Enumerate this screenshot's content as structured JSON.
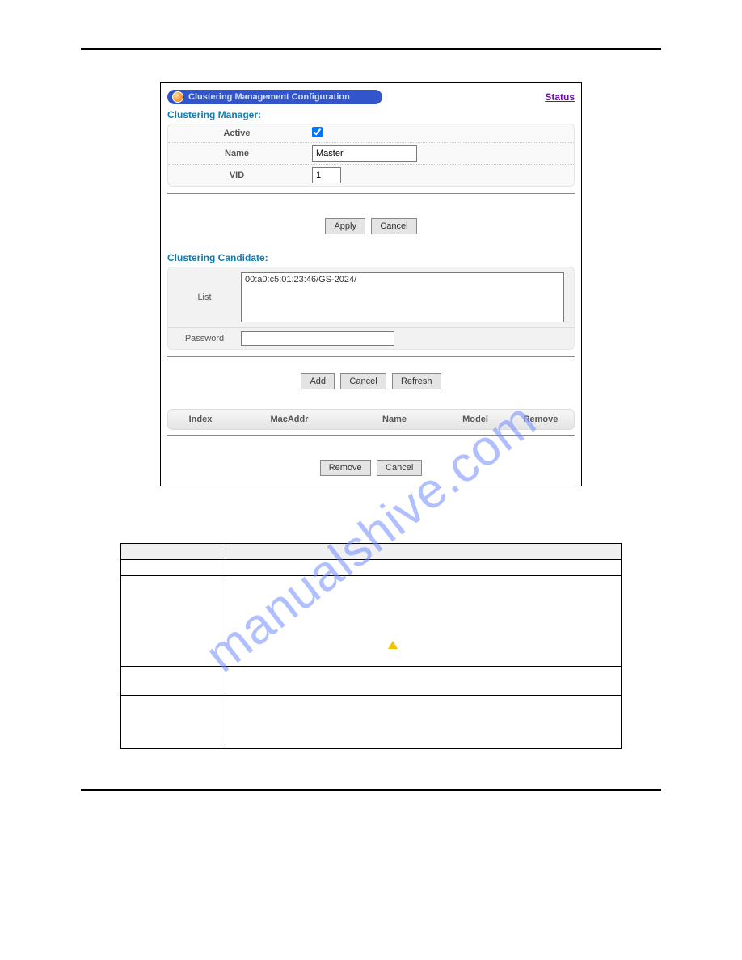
{
  "watermark": "manualshive.com",
  "panel": {
    "title": "Clustering Management Configuration",
    "status_link": "Status"
  },
  "manager": {
    "section_title": "Clustering Manager:",
    "labels": {
      "active": "Active",
      "name": "Name",
      "vid": "VID"
    },
    "values": {
      "name": "Master",
      "vid": "1",
      "active_checked": true
    },
    "buttons": {
      "apply": "Apply",
      "cancel": "Cancel"
    }
  },
  "candidate": {
    "section_title": "Clustering Candidate:",
    "labels": {
      "list": "List",
      "password": "Password"
    },
    "list_item": "00:a0:c5:01:23:46/GS-2024/",
    "buttons": {
      "add": "Add",
      "cancel": "Cancel",
      "refresh": "Refresh"
    }
  },
  "table_header": {
    "index": "Index",
    "mac": "MacAddr",
    "name": "Name",
    "model": "Model",
    "remove": "Remove"
  },
  "bottom_buttons": {
    "remove": "Remove",
    "cancel": "Cancel"
  }
}
